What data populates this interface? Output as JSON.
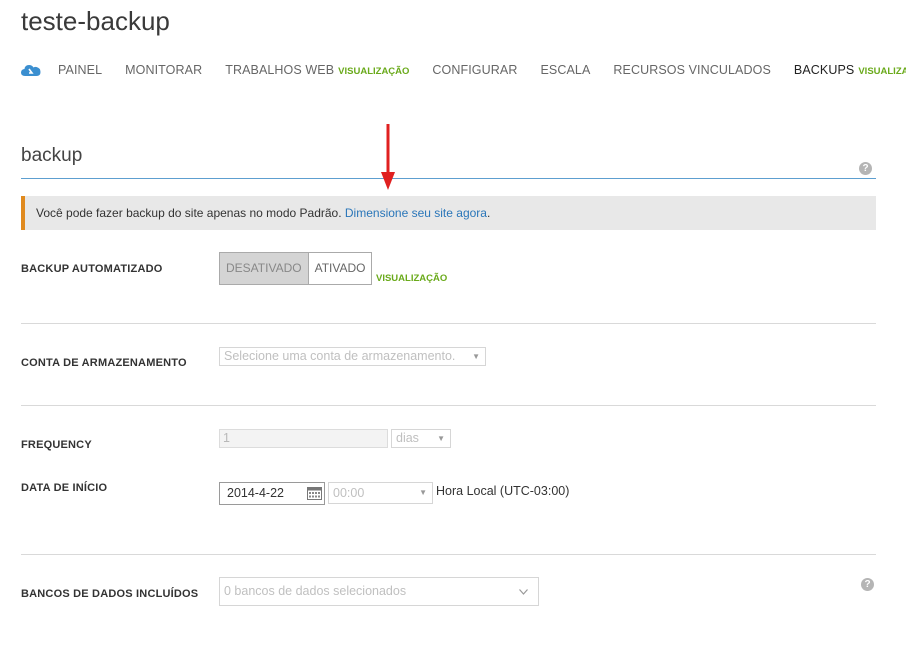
{
  "title": "teste-backup",
  "nav": {
    "items": [
      {
        "label": "PAINEL",
        "preview": ""
      },
      {
        "label": "MONITORAR",
        "preview": ""
      },
      {
        "label": "TRABALHOS WEB",
        "preview": "VISUALIZAÇÃO"
      },
      {
        "label": "CONFIGURAR",
        "preview": ""
      },
      {
        "label": "ESCALA",
        "preview": ""
      },
      {
        "label": "RECURSOS VINCULADOS",
        "preview": ""
      },
      {
        "label": "BACKUPS",
        "preview": "VISUALIZAÇÃO",
        "active": true
      }
    ]
  },
  "section": {
    "title": "backup",
    "help": "?"
  },
  "notice": {
    "text": "Você pode fazer backup do site apenas no modo Padrão. ",
    "link": "Dimensione seu site agora",
    "suffix": "."
  },
  "backup_automatizado": {
    "label": "BACKUP AUTOMATIZADO",
    "off": "DESATIVADO",
    "on": "ATIVADO",
    "selected": "DESATIVADO",
    "preview": "VISUALIZAÇÃO"
  },
  "storage": {
    "label": "CONTA DE ARMAZENAMENTO",
    "placeholder": "Selecione uma conta de armazenamento."
  },
  "frequency": {
    "label": "FREQUENCY",
    "value": "1",
    "unit": "dias"
  },
  "start": {
    "label": "DATA DE INÍCIO",
    "date": "2014-4-22",
    "time": "00:00",
    "timezone": "Hora Local (UTC-03:00)"
  },
  "databases": {
    "label": "BANCOS DE DADOS INCLUÍDOS",
    "value": "0 bancos de dados selecionados",
    "help": "?"
  },
  "colors": {
    "accent": "#5d9fd0",
    "preview": "#6aaa1b",
    "warning": "#e08a1e",
    "link": "#2a76b9",
    "arrow": "#e02020"
  }
}
